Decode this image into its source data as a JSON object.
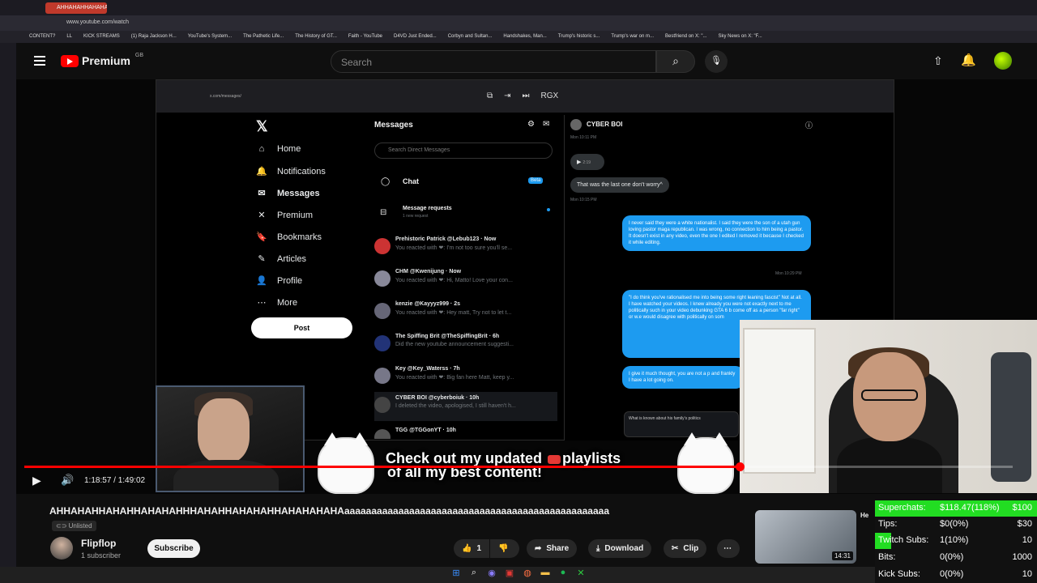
{
  "browser": {
    "tab_title": "AHHAHAHHAHAHAHA",
    "url": "www.youtube.com/watch",
    "bookmarks": [
      "CONTENT?",
      "LL",
      "KICK STREAMS",
      "(1) Raja Jackson H...",
      "YouTube's System...",
      "The Pathetic Life...",
      "The History of GT...",
      "Faith - YouTube",
      "D4VD Just Ended...",
      "Corbyn and Sultan...",
      "Handshakes, Man...",
      "Trump's historic s...",
      "Trump's war on m...",
      "Bestfriend on X: \"...",
      "Sky News on X: \"F..."
    ]
  },
  "youtube_header": {
    "logo_text": "Premium",
    "region": "GB",
    "search_placeholder": "Search"
  },
  "x_app": {
    "nav": [
      {
        "label": "Home",
        "icon": "home-icon"
      },
      {
        "label": "Notifications",
        "icon": "bell-icon"
      },
      {
        "label": "Messages",
        "icon": "mail-icon"
      },
      {
        "label": "Premium",
        "icon": "x-icon"
      },
      {
        "label": "Bookmarks",
        "icon": "bookmark-icon"
      },
      {
        "label": "Articles",
        "icon": "article-icon"
      },
      {
        "label": "Profile",
        "icon": "person-icon"
      },
      {
        "label": "More",
        "icon": "more-icon"
      }
    ],
    "post_label": "Post",
    "messages_title": "Messages",
    "search_placeholder": "Search Direct Messages",
    "chat_label": "Chat",
    "beta_badge": "Beta",
    "requests_title": "Message requests",
    "requests_sub": "1 new request",
    "conversations": [
      {
        "name": "Prehistoric Patrick @Lebub123 · Now",
        "preview": "You reacted with ❤: I'm not too sure you'll se..."
      },
      {
        "name": "CHM @Kwenijung · Now",
        "preview": "You reacted with ❤: Hi, Matto! Love your con..."
      },
      {
        "name": "kenzie @Kayyyz999 · 2s",
        "preview": "You reacted with ❤: Hey matt, Try not to let t..."
      },
      {
        "name": "The Spiffing Brit @TheSpiffingBrit · 6h",
        "preview": "Did the new youtube announcement suggesti..."
      },
      {
        "name": "Key @Key_Waterss · 7h",
        "preview": "You reacted with ❤: Big fan here Matt, keep y..."
      },
      {
        "name": "CYBER BOI @cyberboiuk · 10h",
        "preview": "I deleted the video, apologised, I still haven't h..."
      },
      {
        "name": "TGG @TGGonYT · 10h",
        "preview": ""
      }
    ],
    "chat": {
      "name": "CYBER BOI",
      "audio_duration": "2:19",
      "grey_message": "That was the last one don't worry^",
      "time1": "Mon 10:11 PM",
      "time2": "Mon 10:15 PM",
      "time3": "Mon 10:29 PM",
      "blue_message1": "I never said they were a white nationalist. I said they were the son of a utah gun loving pastor maga republican. I was wrong, no connection to him being a pastor. It doesn't exist in any video, even the one I edited I removed it because I checked it while editing.",
      "blue_message2": "\"I do think you've rationalised me into being some right leaning fascist\" Not at all. I have watched your videos. I knew already you were not exactly next to me politically such in your video debunking GTA 6 b come off as a person \"far right\" or w.e would disagree with politically on som",
      "blue_message3": "I give it much thought, you are not a p and frankly I have a lot going on.",
      "card_title": "What is known about his family's politics"
    }
  },
  "overlay": {
    "banner_line1_pre": "Check out my updated",
    "banner_line1_post": "playlists",
    "banner_line2": "of all my best content!",
    "brand": "RGX"
  },
  "player": {
    "time": "1:18:57 / 1:49:02",
    "progress_fraction": 0.724
  },
  "video": {
    "title": "AHHAHAHHAHAHHAHAHAHHHAHAHHAHAHAHHAHAHAHAHAaaaaaaaaaaaaaaaaaaaaaaaaaaaaaaaaaaaaaaaaaaaaaaaaa",
    "visibility": "Unlisted",
    "channel": "Flipflop",
    "subscribers": "1 subscriber",
    "subscribe_label": "Subscribe",
    "likes": "1",
    "share_label": "Share",
    "download_label": "Download",
    "clip_label": "Clip"
  },
  "suggested": {
    "duration": "14:31",
    "title_fragment": "He"
  },
  "stream_stats": [
    {
      "label": "Superchats:",
      "count": "$118.47(118%)",
      "goal": "$100",
      "fill": 1.0
    },
    {
      "label": "Tips:",
      "count": "$0(0%)",
      "goal": "$30",
      "fill": 0.0
    },
    {
      "label": "Twitch Subs:",
      "count": "1(10%)",
      "goal": "10",
      "fill": 0.1
    },
    {
      "label": "Bits:",
      "count": "0(0%)",
      "goal": "1000",
      "fill": 0.0
    },
    {
      "label": "Kick Subs:",
      "count": "0(0%)",
      "goal": "10",
      "fill": 0.0
    }
  ],
  "colors": {
    "accent": "#ff0000",
    "x_blue": "#1d9bf0",
    "stats_green": "#22dd22"
  }
}
